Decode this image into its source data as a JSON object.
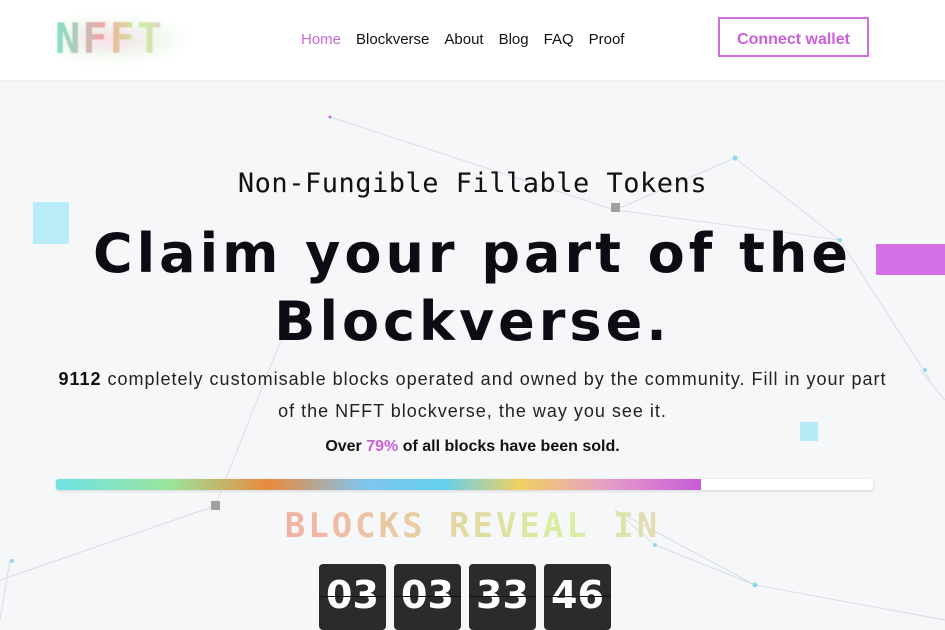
{
  "brand": {
    "logo_text": "NFFT"
  },
  "nav": {
    "items": [
      {
        "label": "Home",
        "active": true
      },
      {
        "label": "Blockverse",
        "active": false
      },
      {
        "label": "About",
        "active": false
      },
      {
        "label": "Blog",
        "active": false
      },
      {
        "label": "FAQ",
        "active": false
      },
      {
        "label": "Proof",
        "active": false
      }
    ],
    "connect_label": "Connect wallet"
  },
  "hero": {
    "subtitle": "Non-Fungible Fillable Tokens",
    "headline_line1": "Claim your part of the",
    "headline_line2": "Blockverse.",
    "desc_count": "9112",
    "desc_rest": " completely customisable blocks operated and owned by the community. Fill in your part of the NFFT blockverse, the way you see it.",
    "sold_prefix": "Over ",
    "sold_pct": "79%",
    "sold_suffix": " of all blocks have been sold.",
    "progress_percent": 79,
    "reveal_label": "BLOCKS REVEAL IN",
    "countdown": [
      "03",
      "03",
      "33",
      "46"
    ]
  },
  "colors": {
    "accent": "#cc5fdd",
    "text": "#111111",
    "background": "#f6f7f9",
    "countdown_bg": "#2b2b2b"
  }
}
